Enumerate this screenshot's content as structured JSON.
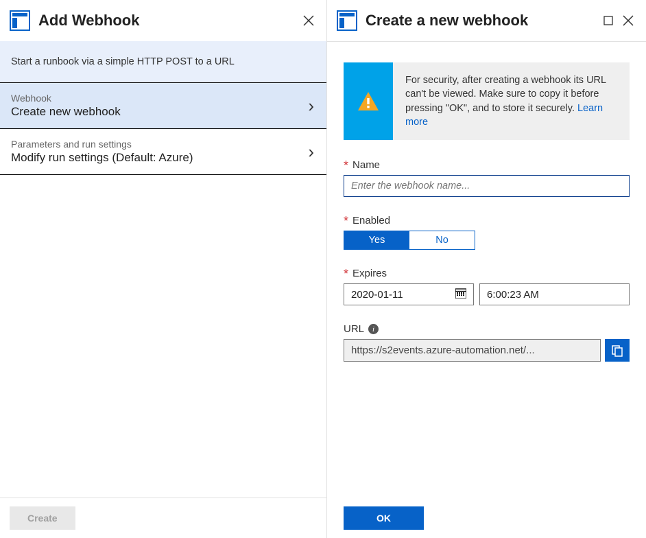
{
  "left": {
    "title": "Add Webhook",
    "description": "Start a runbook via a simple HTTP POST to a URL",
    "items": [
      {
        "label": "Webhook",
        "title": "Create new webhook"
      },
      {
        "label": "Parameters and run settings",
        "title": "Modify run settings (Default: Azure)"
      }
    ],
    "create_label": "Create"
  },
  "right": {
    "title": "Create a new webhook",
    "info_text": "For security, after creating a webhook its URL can't be viewed. Make sure to copy it before pressing \"OK\", and to store it securely. ",
    "info_link": "Learn more",
    "name_label": "Name",
    "name_placeholder": "Enter the webhook name...",
    "enabled_label": "Enabled",
    "enabled_yes": "Yes",
    "enabled_no": "No",
    "expires_label": "Expires",
    "expires_date": "2020-01-11",
    "expires_time": "6:00:23 AM",
    "url_label": "URL",
    "url_value": "https://s2events.azure-automation.net/...",
    "ok_label": "OK"
  }
}
